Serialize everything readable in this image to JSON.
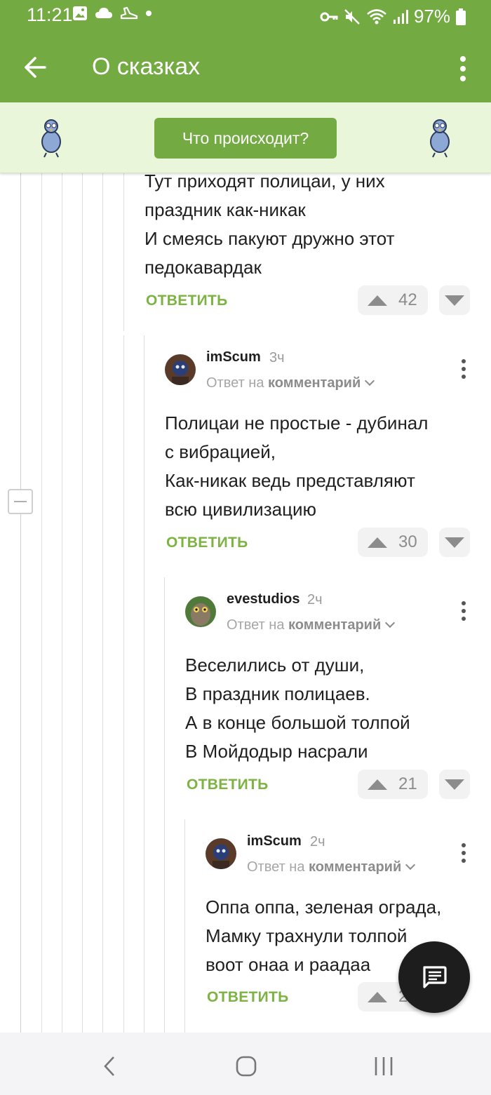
{
  "status_bar": {
    "time": "11:21",
    "battery": "97%"
  },
  "app_bar": {
    "title": "О сказках"
  },
  "banner": {
    "button_label": "Что происходит?"
  },
  "comments": [
    {
      "text": "Тут приходят полицаи, у них\nпраздник как-никак\nИ смеясь пакуют дружно этот\nпедокавардак",
      "reply_label": "ОТВЕТИТЬ",
      "votes": "42"
    },
    {
      "author": "imScum",
      "ago": "3ч",
      "reply_to_prefix": "Ответ на",
      "reply_to_target": "комментарий",
      "text": "Полицаи не простые - дубинал\nс вибрацией,\nКак-никак ведь представляют\nвсю цивилизацию",
      "reply_label": "ОТВЕТИТЬ",
      "votes": "30"
    },
    {
      "author": "evestudios",
      "ago": "2ч",
      "reply_to_prefix": "Ответ на",
      "reply_to_target": "комментарий",
      "text": "Веселились от души,\nВ праздник полицаев.\nА в конце большой толпой\nВ Мойдодыр насрали",
      "reply_label": "ОТВЕТИТЬ",
      "votes": "21"
    },
    {
      "author": "imScum",
      "ago": "2ч",
      "reply_to_prefix": "Ответ на",
      "reply_to_target": "комментарий",
      "text": "Оппа оппа, зеленая ограда,\nМамку трахнули толпой\nвоот онаа и раадаа",
      "reply_label": "ОТВЕТИТЬ",
      "votes": "2"
    }
  ],
  "icons": {
    "back": "arrow-left-icon",
    "more": "more-vertical-icon",
    "fab": "comment-icon",
    "upvote": "triangle-up-icon",
    "downvote": "triangle-down-icon"
  },
  "colors": {
    "brand_green": "#73aa42",
    "banner_bg": "#eaf6d9",
    "reply_green": "#7cb342"
  }
}
